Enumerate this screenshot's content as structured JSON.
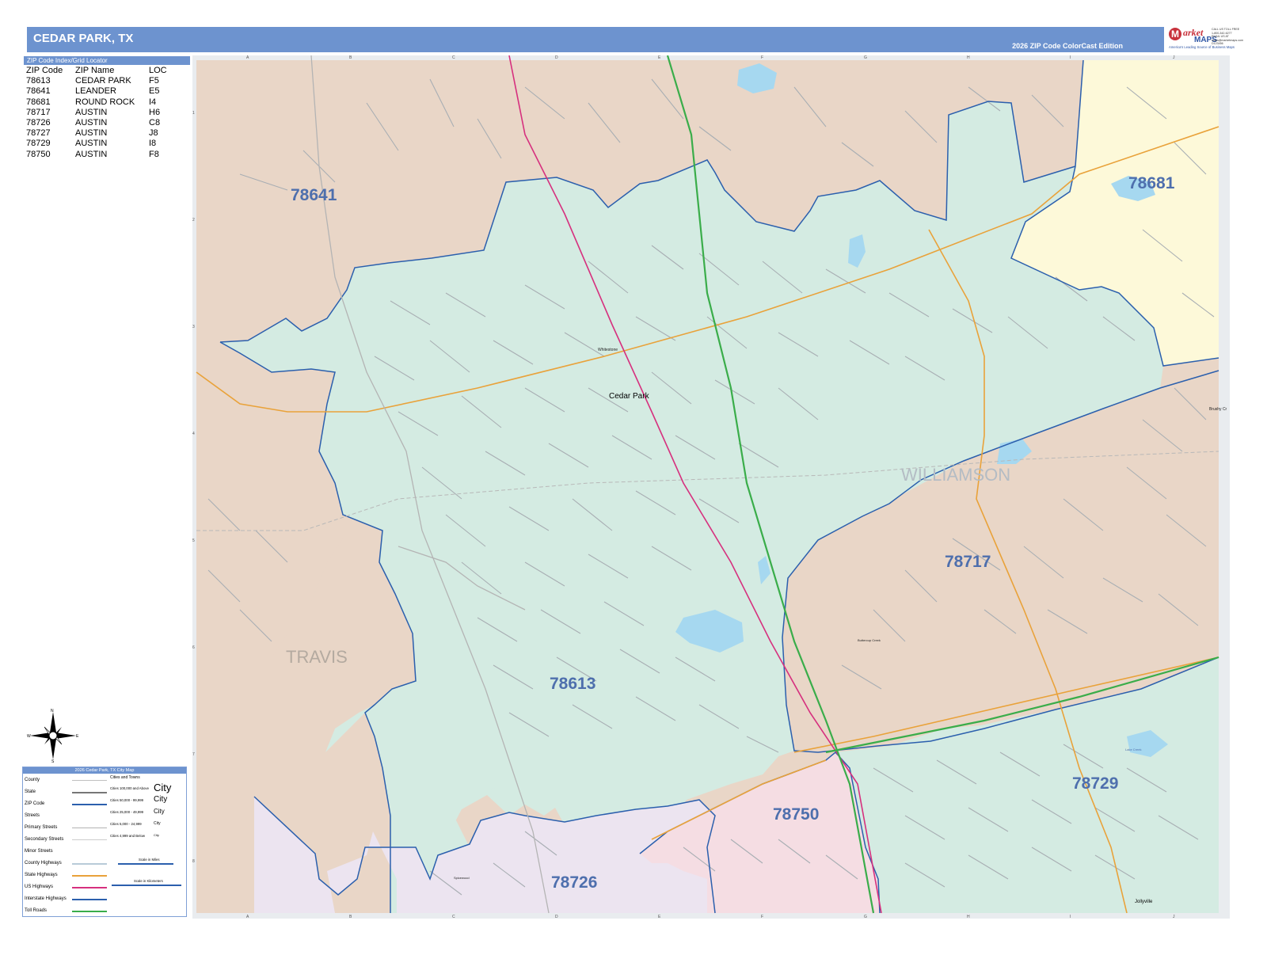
{
  "header": {
    "title": "CEDAR PARK, TX",
    "edition": "2026 ZIP Code ColorCast Edition"
  },
  "logo": {
    "badge": "M",
    "name": "arket",
    "maps": "MAPS",
    "tagline": "America's Leading Source of Business Maps",
    "contact": [
      "CALL US TOLL FREE",
      "1-800-342-6277",
      "EMAIL US AT",
      "maps@marketmaps.com",
      "D123456"
    ]
  },
  "index": {
    "header": "ZIP Code Index/Grid Locator",
    "columns": [
      "ZIP Code",
      "ZIP Name",
      "LOC"
    ],
    "rows": [
      [
        "78613",
        "CEDAR PARK",
        "F5"
      ],
      [
        "78641",
        "LEANDER",
        "E5"
      ],
      [
        "78681",
        "ROUND ROCK",
        "I4"
      ],
      [
        "78717",
        "AUSTIN",
        "H6"
      ],
      [
        "78726",
        "AUSTIN",
        "C8"
      ],
      [
        "78727",
        "AUSTIN",
        "J8"
      ],
      [
        "78729",
        "AUSTIN",
        "I8"
      ],
      [
        "78750",
        "AUSTIN",
        "F8"
      ]
    ]
  },
  "map": {
    "zip_labels": [
      {
        "zip": "78641"
      },
      {
        "zip": "78681"
      },
      {
        "zip": "78717"
      },
      {
        "zip": "78613"
      },
      {
        "zip": "78729"
      },
      {
        "zip": "78750"
      },
      {
        "zip": "78726"
      }
    ],
    "county_labels": [
      "WILLIAMSON",
      "TRAVIS"
    ],
    "city_labels": [
      "Cedar Park",
      "Jollyville"
    ],
    "small_labels": [
      "Whitestone",
      "Buttercup Creek",
      "Brushy Cr",
      "Lake Creek",
      "Spicewood"
    ],
    "grid_cols": [
      "A",
      "B",
      "C",
      "D",
      "E",
      "F",
      "G",
      "H",
      "I",
      "J"
    ],
    "grid_rows": [
      "1",
      "2",
      "3",
      "4",
      "5",
      "6",
      "7",
      "8"
    ],
    "colors": {
      "78613": "#d4ebe2",
      "78641": "#e9d6c7",
      "78681": "#fdf9d9",
      "78717": "#e9d6c7",
      "78729": "#d4ebe2",
      "78750": "#f5dde3",
      "78726": "#ece4f0",
      "zip_boundary": "#2b5fad",
      "water": "#a6d8f0",
      "interstate": "#3aad4a",
      "us_highway": "#d6307e",
      "state_highway": "#e9a23a",
      "label": "#4e6fad"
    }
  },
  "compass": {
    "n": "N",
    "s": "S",
    "e": "E",
    "w": "W"
  },
  "legend": {
    "title": "2026 Cedar Park, TX City Map",
    "items": [
      "County",
      "State",
      "ZIP Code",
      "Streets",
      "Primary Streets",
      "Secondary Streets",
      "Minor Streets",
      "County Highways",
      "State Highways",
      "US Highways",
      "Interstate Highways",
      "Toll Roads"
    ],
    "cities_title": "Cities and Towns",
    "city_ranges": [
      "Cities 100,000 and Above",
      "Cities 50,000 - 99,999",
      "Cities 25,000 - 49,999",
      "Cities 5,000 - 24,999",
      "Cities 4,999 and Below"
    ],
    "city_sample": "City",
    "scale_miles": "Scale in Miles",
    "scale_km": "Scale in Kilometers"
  }
}
